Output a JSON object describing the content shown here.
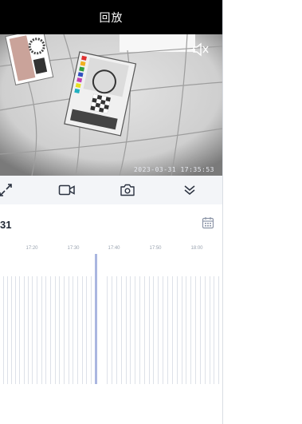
{
  "title": "回放",
  "video": {
    "timestamp": "2023-03-31 17:35:53",
    "mute_icon": "speaker-muted-icon"
  },
  "controls": [
    {
      "name": "fullscreen-button",
      "icon": "expand-arrows-icon"
    },
    {
      "name": "record-button",
      "icon": "video-camera-icon"
    },
    {
      "name": "snapshot-button",
      "icon": "camera-icon"
    },
    {
      "name": "collapse-button",
      "icon": "double-chevron-down-icon"
    }
  ],
  "date": {
    "text": "31",
    "calendar_icon": "calendar-icon"
  },
  "timeline": {
    "ticks": [
      "17:20",
      "17:30",
      "17:40",
      "17:50",
      "18:00"
    ]
  },
  "colors": {
    "accent": "#aab6e0",
    "titlebar": "#000000"
  }
}
